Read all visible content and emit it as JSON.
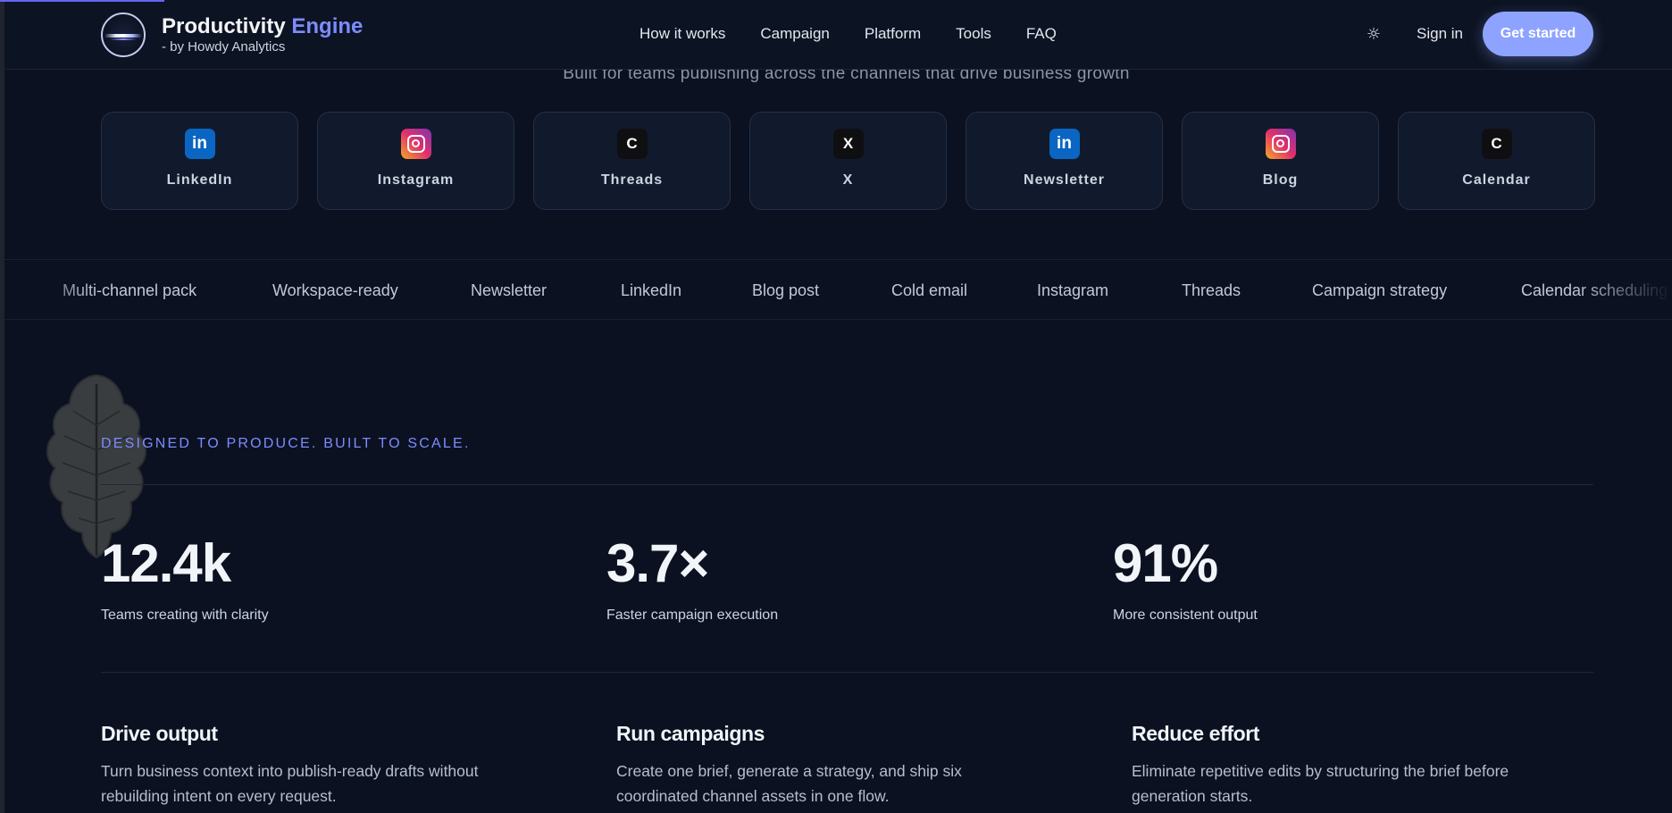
{
  "header": {
    "brand_title": "Productivity",
    "brand_accent": "Engine",
    "brand_sub": "- by Howdy Analytics",
    "nav": [
      "How it works",
      "Campaign",
      "Platform",
      "Tools",
      "FAQ"
    ],
    "theme_icon": "sun-icon",
    "sign_in": "Sign in",
    "cta": "Get started"
  },
  "subtitle": "Built for teams publishing across the channels that drive business growth",
  "channels": [
    {
      "label": "LinkedIn",
      "icon": "linkedin-icon",
      "glyph": "in"
    },
    {
      "label": "Instagram",
      "icon": "instagram-icon",
      "glyph": ""
    },
    {
      "label": "Threads",
      "icon": "threads-icon",
      "glyph": "C"
    },
    {
      "label": "X",
      "icon": "x-icon",
      "glyph": "X"
    },
    {
      "label": "Newsletter",
      "icon": "linkedin-icon",
      "glyph": "in"
    },
    {
      "label": "Blog",
      "icon": "instagram-icon",
      "glyph": ""
    },
    {
      "label": "Calendar",
      "icon": "threads-icon",
      "glyph": "C"
    }
  ],
  "marquee": [
    "Multi-channel pack",
    "Workspace-ready",
    "Newsletter",
    "LinkedIn",
    "Blog post",
    "Cold email",
    "Instagram",
    "Threads",
    "Campaign strategy",
    "Calendar scheduling"
  ],
  "eyebrow": "DESIGNED TO PRODUCE. BUILT TO SCALE.",
  "stats": [
    {
      "value": "12.4k",
      "label": "Teams creating with clarity"
    },
    {
      "value": "3.7×",
      "label": "Faster campaign execution"
    },
    {
      "value": "91%",
      "label": "More consistent output"
    }
  ],
  "features": [
    {
      "title": "Drive output",
      "desc": "Turn business context into publish-ready drafts without rebuilding intent on every request."
    },
    {
      "title": "Run campaigns",
      "desc": "Create one brief, generate a strategy, and ship six coordinated channel assets in one flow."
    },
    {
      "title": "Reduce effort",
      "desc": "Eliminate repetitive edits by structuring the brief before generation starts."
    }
  ],
  "colors": {
    "accent": "#7c8cff",
    "cta": "#8ea3ff",
    "background": "#0b1120",
    "card": "#111a2c"
  }
}
